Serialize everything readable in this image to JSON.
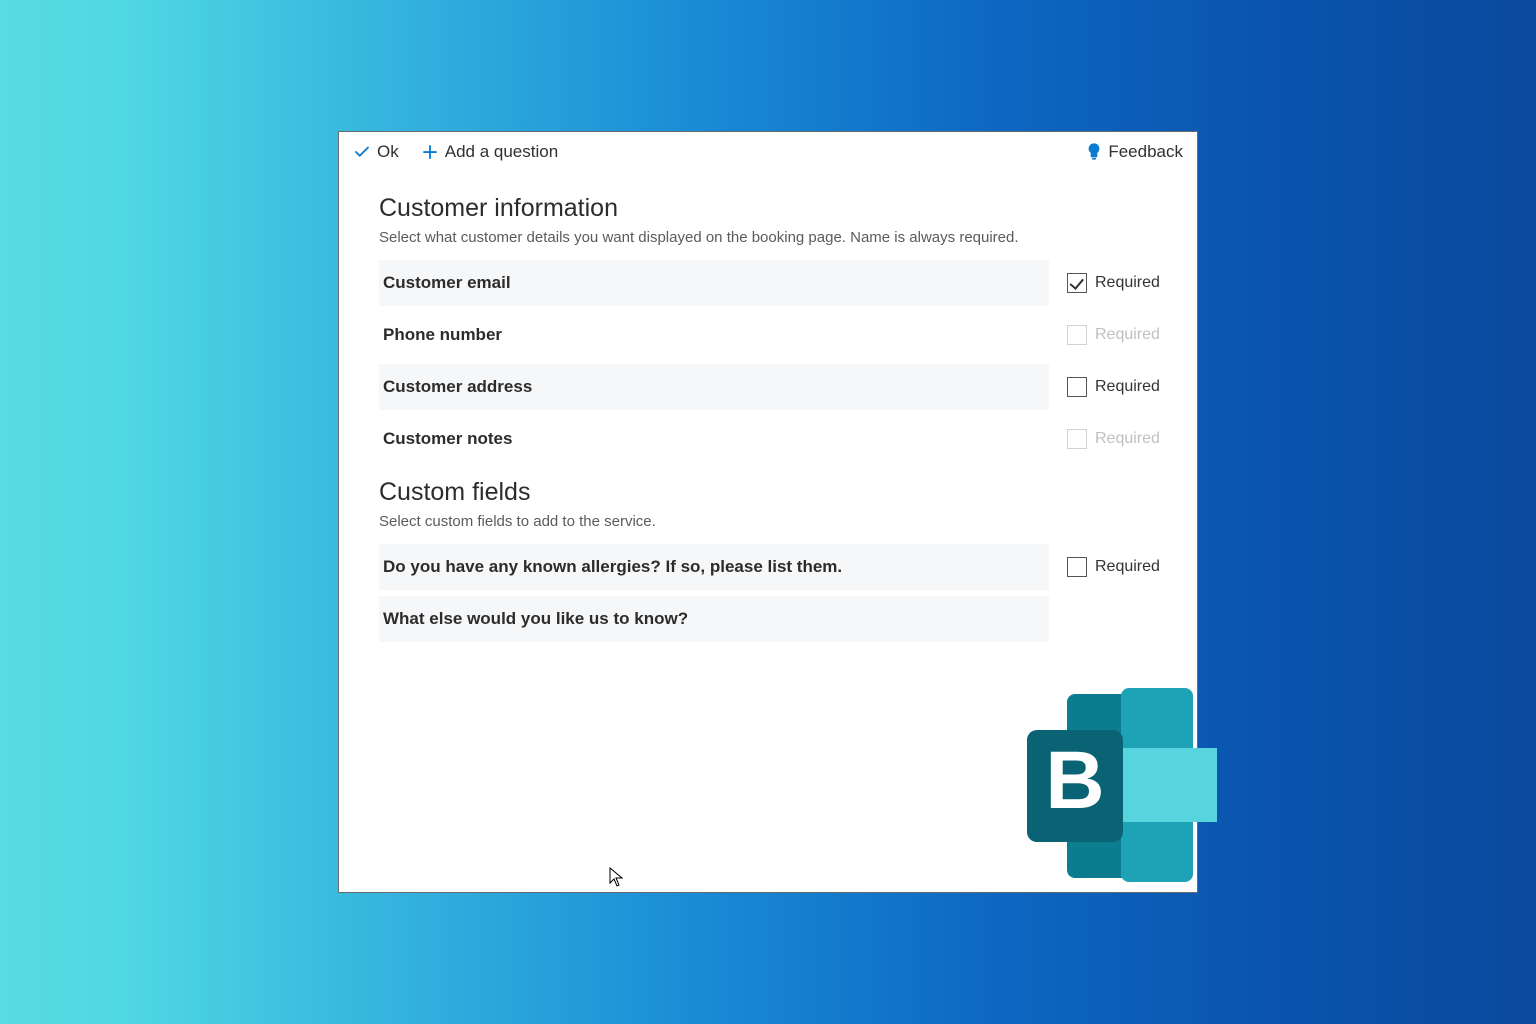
{
  "toolbar": {
    "ok_label": "Ok",
    "add_question_label": "Add a question",
    "feedback_label": "Feedback"
  },
  "section_customer": {
    "title": "Customer information",
    "subtitle": "Select what customer details you want displayed on the booking page. Name is always required.",
    "required_label": "Required",
    "fields": [
      {
        "label": "Customer email",
        "shaded": true,
        "checked": true,
        "enabled": true
      },
      {
        "label": "Phone number",
        "shaded": false,
        "checked": false,
        "enabled": false
      },
      {
        "label": "Customer address",
        "shaded": true,
        "checked": false,
        "enabled": true
      },
      {
        "label": "Customer notes",
        "shaded": false,
        "checked": false,
        "enabled": false
      }
    ]
  },
  "section_custom": {
    "title": "Custom fields",
    "subtitle": "Select custom fields to add to the service.",
    "required_label": "Required",
    "fields": [
      {
        "label": "Do you have any known allergies? If so, please list them.",
        "shaded": true,
        "checked": false,
        "enabled": true
      },
      {
        "label": "What else would you like us to know?",
        "shaded": true,
        "checked": false,
        "enabled": null
      }
    ]
  },
  "logo_letter": "B",
  "colors": {
    "accent": "#0b7bd1",
    "teal_dark": "#0a7d8f",
    "teal_mid": "#1da3b5",
    "teal_light": "#58d4df"
  }
}
